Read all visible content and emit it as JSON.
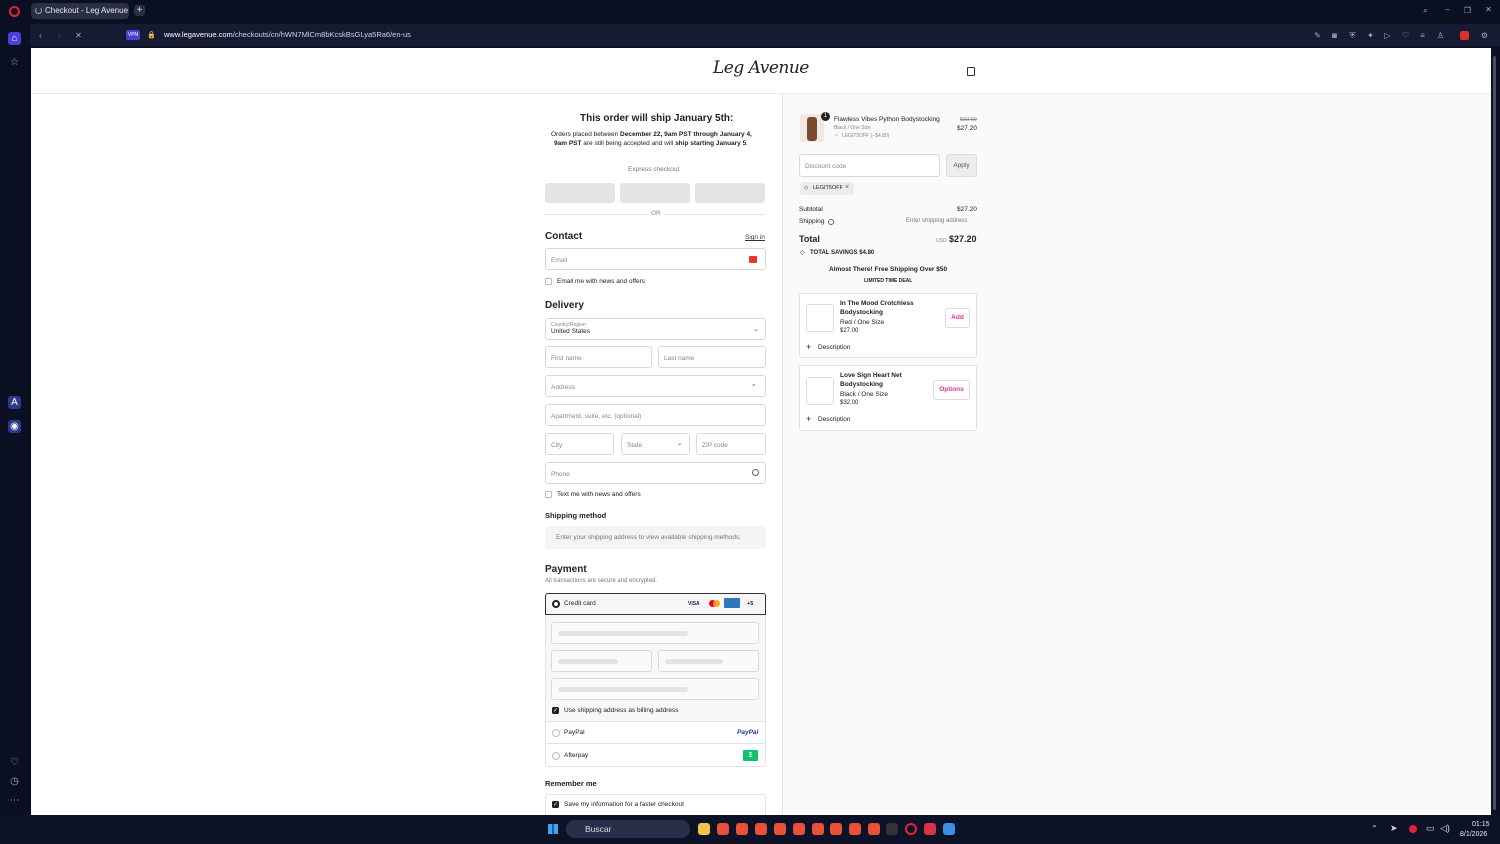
{
  "browser": {
    "tab_title": "Checkout - Leg Avenue",
    "new_tab": "+",
    "url_host": "www.legavenue.com",
    "url_path": "/checkouts/cn/hWN7MlCm8bKcskBsGLya5Ra6/en-us",
    "vpn": "VPN"
  },
  "header": {
    "logo": "Leg Avenue"
  },
  "notice": {
    "title": "This order will ship January 5th:",
    "line1_a": "Orders placed between ",
    "line1_b": "December 22, 9am PST through January 4,",
    "line2_a": "9am PST",
    "line2_b": " are still being accepted and will ",
    "line2_c": "ship starting January 5",
    "line2_d": "."
  },
  "express": {
    "label": "Express checkout",
    "or": "OR"
  },
  "contact": {
    "title": "Contact",
    "sign_in": "Sign in",
    "email_placeholder": "Email",
    "news_label": "Email me with news and offers"
  },
  "delivery": {
    "title": "Delivery",
    "country_label": "Country/Region",
    "country_value": "United States",
    "first_name": "First name",
    "last_name": "Last name",
    "address": "Address",
    "apartment": "Apartment, suite, etc. (optional)",
    "city": "City",
    "state": "State",
    "zip": "ZIP code",
    "phone": "Phone",
    "text_news": "Text me with news and offers"
  },
  "shipping_method": {
    "title": "Shipping method",
    "info": "Enter your shipping address to view available shipping methods."
  },
  "payment": {
    "title": "Payment",
    "subtitle": "All transactions are secure and encrypted.",
    "credit_card": "Credit card",
    "card_visa": "VISA",
    "card_more": "+5",
    "billing_same": "Use shipping address as billing address",
    "paypal": "PayPal",
    "paypal_logo": "PayPal",
    "afterpay": "Afterpay",
    "afterpay_logo": "$"
  },
  "remember": {
    "title": "Remember me",
    "save_label": "Save my information for a faster checkout"
  },
  "summary": {
    "item": {
      "qty": "1",
      "name": "Flawless Vibes Python Bodystocking",
      "variant": "Black / One Size",
      "discount": "LEGIT5OFF (−$4.80)",
      "old_price": "$32.00",
      "price": "$27.20"
    },
    "discount_placeholder": "Discount code",
    "apply": "Apply",
    "applied_code": "LEGIT5OFF",
    "subtotal_label": "Subtotal",
    "subtotal_value": "$27.20",
    "shipping_label": "Shipping",
    "shipping_value": "Enter shipping address",
    "total_label": "Total",
    "currency": "USD",
    "total_value": "$27.20",
    "savings": "TOTAL SAVINGS  $4.80",
    "promo_title": "Almost There! Free Shipping Over $50",
    "promo_sub": "LIMITED TIME DEAL",
    "upsells": [
      {
        "name1": "In The Mood Crotchless",
        "name2": "Bodystocking",
        "variant": "Red / One Size",
        "price": "$27.00",
        "action": "Add",
        "desc": "Description"
      },
      {
        "name1": "Love Sign Heart Net",
        "name2": "Bodystocking",
        "variant": "Black / One Size",
        "price": "$32.00",
        "action": "Options",
        "desc": "Description"
      }
    ]
  },
  "taskbar": {
    "search": "Buscar",
    "time": "01:15",
    "date": "8/1/2026"
  },
  "colors": {
    "accent_pink": "#e2328c",
    "paypal_blue": "#1e3c8c",
    "afterpay_green": "#11c26b"
  }
}
